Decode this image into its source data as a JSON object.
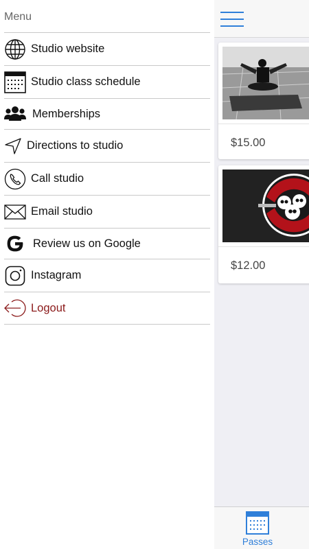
{
  "drawer": {
    "title": "Menu",
    "items": [
      {
        "label": "Studio website",
        "icon": "globe-icon"
      },
      {
        "label": "Studio class schedule",
        "icon": "calendar-icon"
      },
      {
        "label": "Memberships",
        "icon": "users-icon"
      },
      {
        "label": "Directions to studio",
        "icon": "navigation-arrow-icon"
      },
      {
        "label": "Call studio",
        "icon": "phone-icon"
      },
      {
        "label": "Email studio",
        "icon": "envelope-icon"
      },
      {
        "label": "Review us on Google",
        "icon": "google-icon"
      },
      {
        "label": "Instagram",
        "icon": "instagram-icon"
      },
      {
        "label": "Logout",
        "icon": "logout-icon"
      }
    ]
  },
  "main": {
    "cards": [
      {
        "price": "$15.00"
      },
      {
        "price": "$12.00"
      }
    ],
    "tabbar": {
      "tabs": [
        {
          "label": "Passes",
          "icon": "calendar-icon"
        }
      ]
    }
  },
  "colors": {
    "accent": "#2f7fd9",
    "logout": "#8b1a1a",
    "background": "#efeff4"
  }
}
